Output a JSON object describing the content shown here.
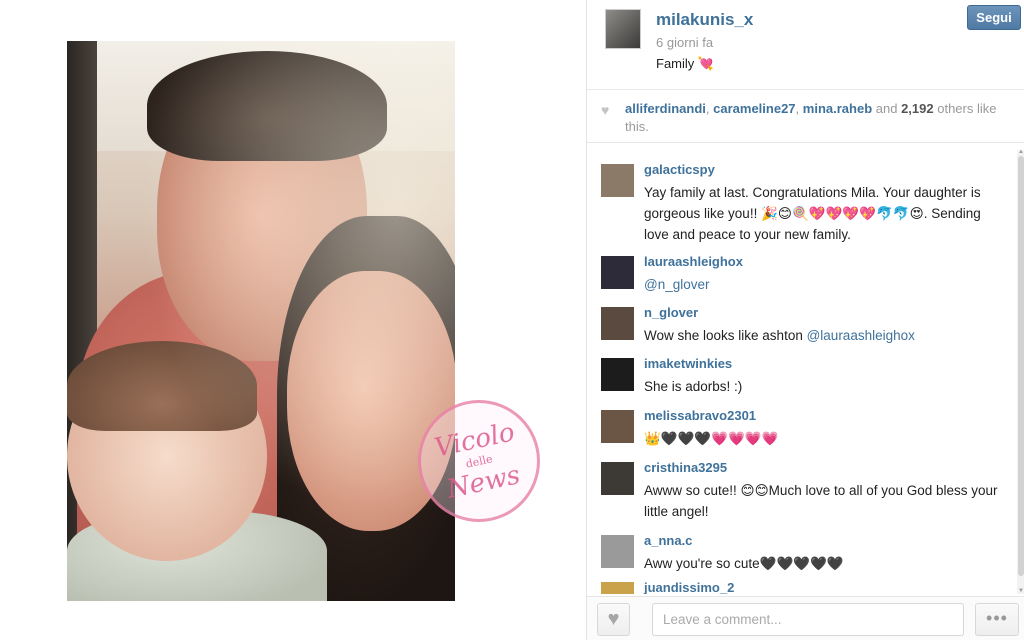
{
  "post": {
    "username": "milakunis_x",
    "time_ago": "6 giorni fa",
    "caption": "Family 💘",
    "follow_label": "Segui"
  },
  "watermark": {
    "line1": "Vicolo",
    "line2": "delle",
    "line3": "News"
  },
  "likes": {
    "likers": [
      "alliferdinandi",
      "carameline27",
      "mina.raheb"
    ],
    "sep1": ", ",
    "sep2": ", ",
    "and_text": " and ",
    "count": "2,192",
    "suffix": " others like this."
  },
  "comments": [
    {
      "user": "galacticspy",
      "text": "Yay family at last. Congratulations Mila. Your daughter is gorgeous like you!! 🎉😊🍭💖💖💖💖🐬🐬😍. Sending love and peace to your new family.",
      "avatar_color": "#8c7a68"
    },
    {
      "user": "lauraashleighox",
      "mention": "@n_glover",
      "text": "",
      "avatar_color": "#2d2a3a"
    },
    {
      "user": "n_glover",
      "text": "Wow she looks like ashton ",
      "mention": "@lauraashleighox",
      "avatar_color": "#5a4a40"
    },
    {
      "user": "imaketwinkies",
      "text": "She is adorbs! :)",
      "avatar_color": "#1c1c1c"
    },
    {
      "user": "melissabravo2301",
      "text": "👑🖤🖤🖤💗💗💗💗",
      "avatar_color": "#6b5545"
    },
    {
      "user": "cristhina3295",
      "text": "Awww so cute!! 😊😊Much love to all of you God bless your little angel!",
      "avatar_color": "#3d3a36"
    },
    {
      "user": "a_nna.c",
      "text": "Aww you're so cute🖤🖤🖤🖤🖤",
      "avatar_color": "#9a9a9a"
    },
    {
      "user": "juandissimo_2",
      "text": "",
      "avatar_color": "#c9a24a"
    }
  ],
  "footer": {
    "comment_placeholder": "Leave a comment...",
    "more_label": "•••",
    "like_icon": "♥"
  },
  "colors": {
    "link_blue": "#3f729b",
    "follow_button": "#5780a9"
  }
}
